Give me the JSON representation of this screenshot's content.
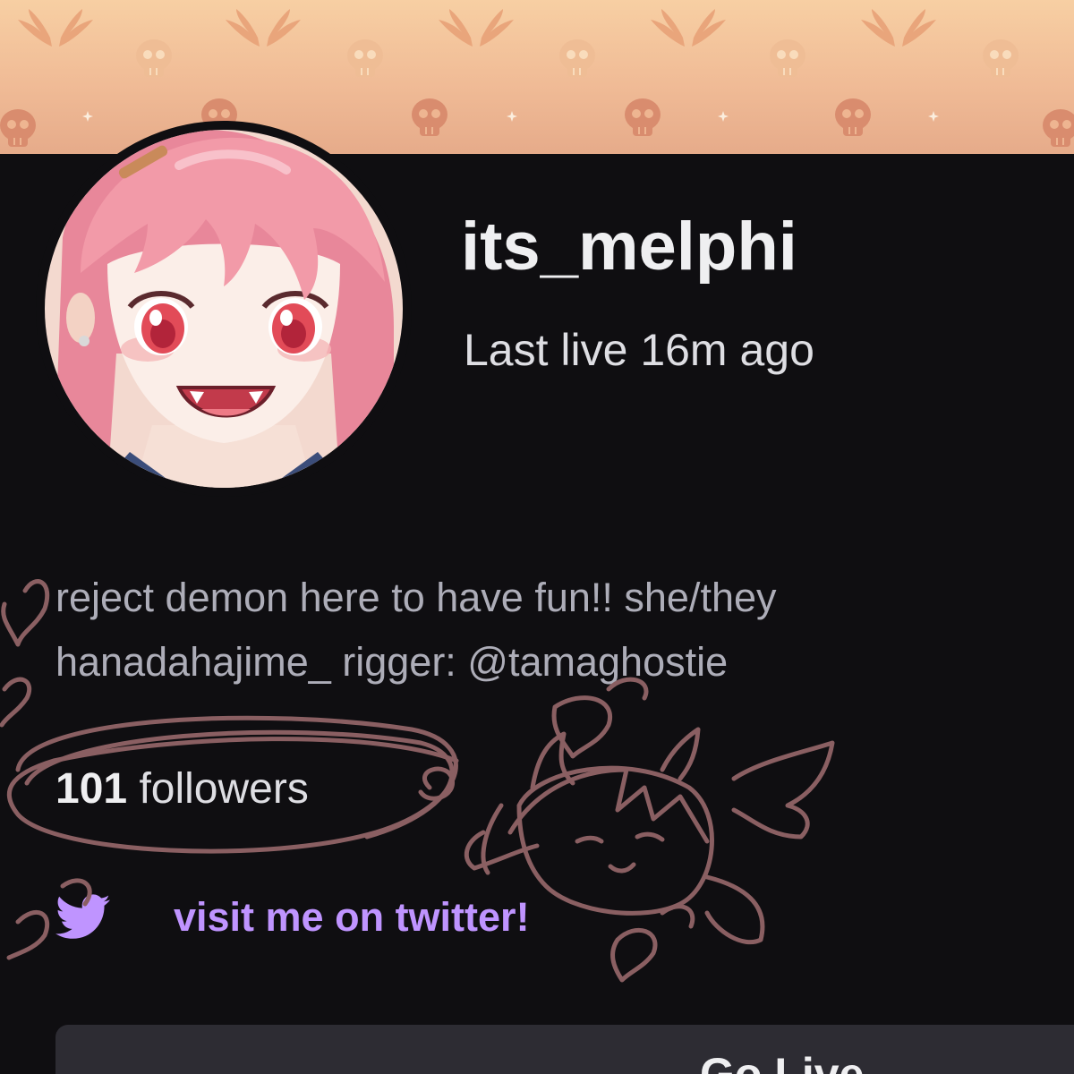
{
  "profile": {
    "username": "its_melphi",
    "last_live": "Last live 16m ago",
    "bio_line_1": "reject demon here to have fun!! she/they",
    "bio_line_2": "hanadahajime_ rigger: @tamaghostie",
    "followers_count": "101",
    "followers_label": "followers",
    "twitter_label": "visit me on twitter!",
    "bottom_panel_text": "Go Live"
  },
  "colors": {
    "background": "#0f0e11",
    "banner": "#f0bb96",
    "link_purple": "#bf94ff",
    "doodle_ink": "#8a5f62",
    "avatar_hair": "#f29aa8"
  },
  "icons": {
    "banner_pattern": [
      "wings-icon",
      "skull-icon",
      "sparkle-icon"
    ],
    "link": "twitter-bird-icon"
  }
}
